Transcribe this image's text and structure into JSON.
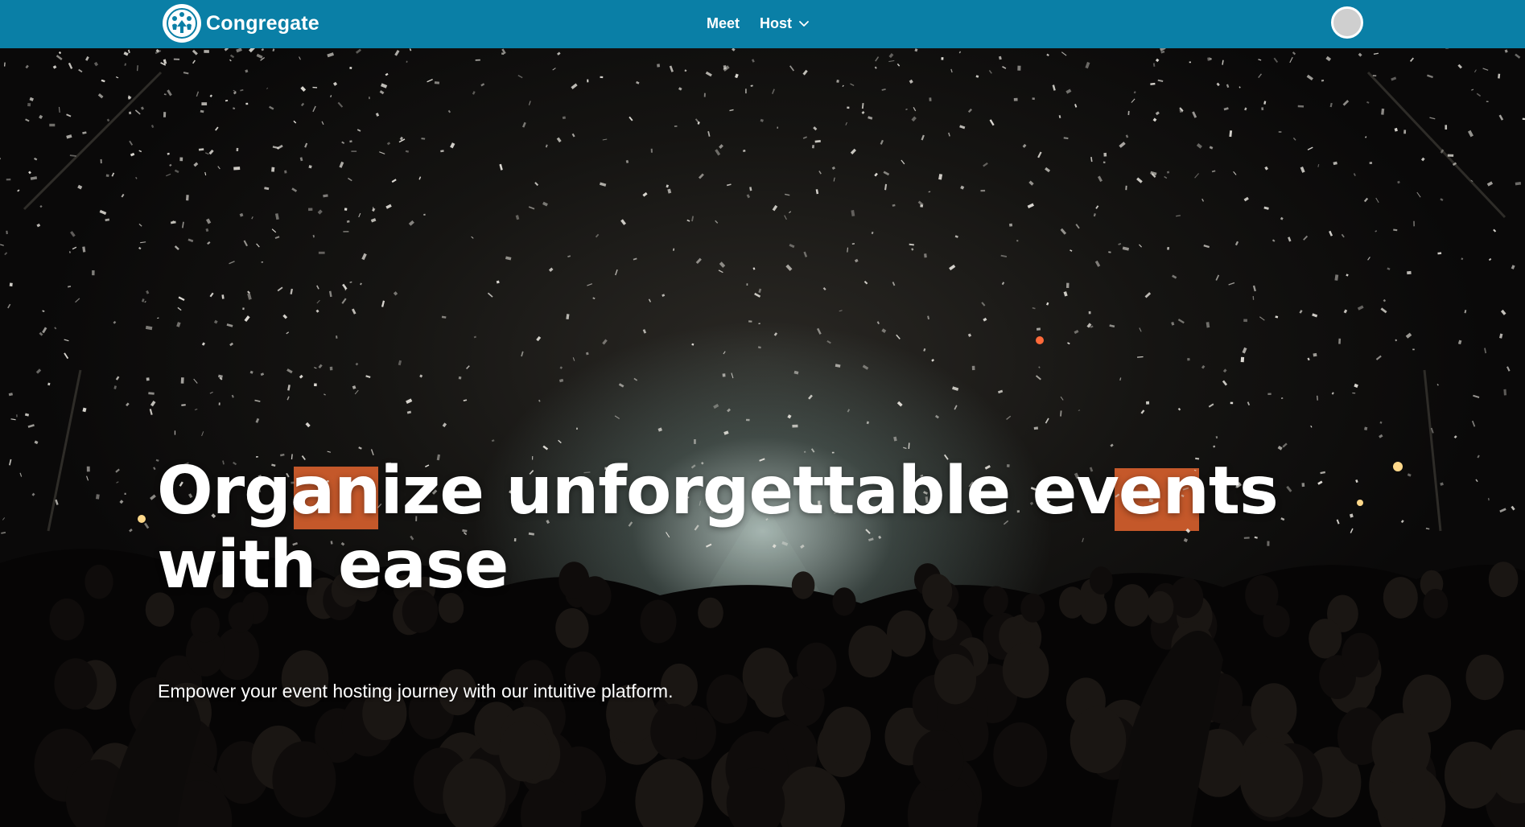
{
  "brand": {
    "name": "Congregate",
    "logo_icon": "people-group-icon"
  },
  "nav": {
    "items": [
      {
        "label": "Meet"
      },
      {
        "label": "Host",
        "icon": "chevron-down-icon"
      }
    ]
  },
  "user": {
    "avatar_icon": "avatar-circle"
  },
  "hero": {
    "title": "Organize unforgettable events with ease",
    "subtitle": "Empower your event hosting journey with our intuitive platform."
  },
  "colors": {
    "navbar": "#0a7fa6",
    "text": "#ffffff",
    "avatar": "#cfcfcf",
    "stage_light": "#e8783a"
  }
}
